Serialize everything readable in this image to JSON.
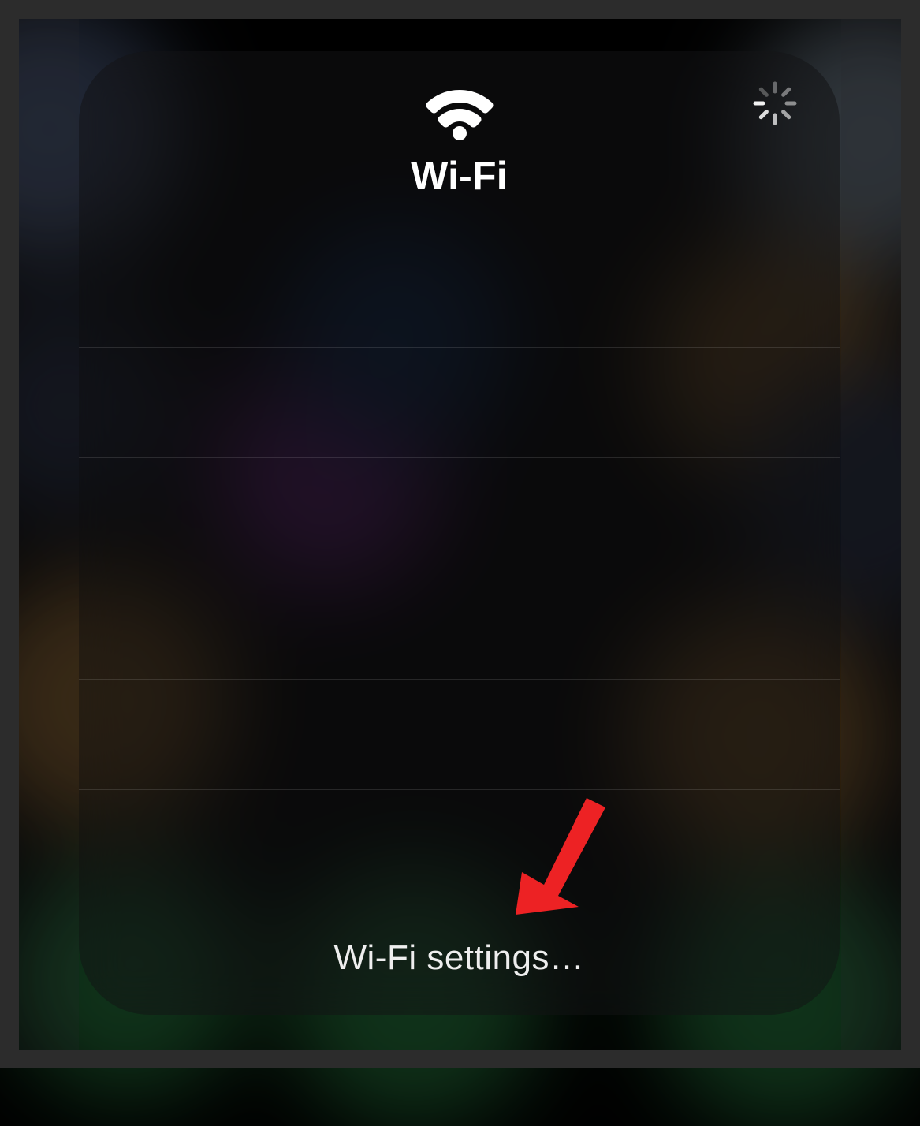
{
  "header": {
    "title": "Wi-Fi"
  },
  "footer": {
    "settings_label": "Wi-Fi settings…"
  },
  "colors": {
    "arrow": "#ed2224"
  }
}
